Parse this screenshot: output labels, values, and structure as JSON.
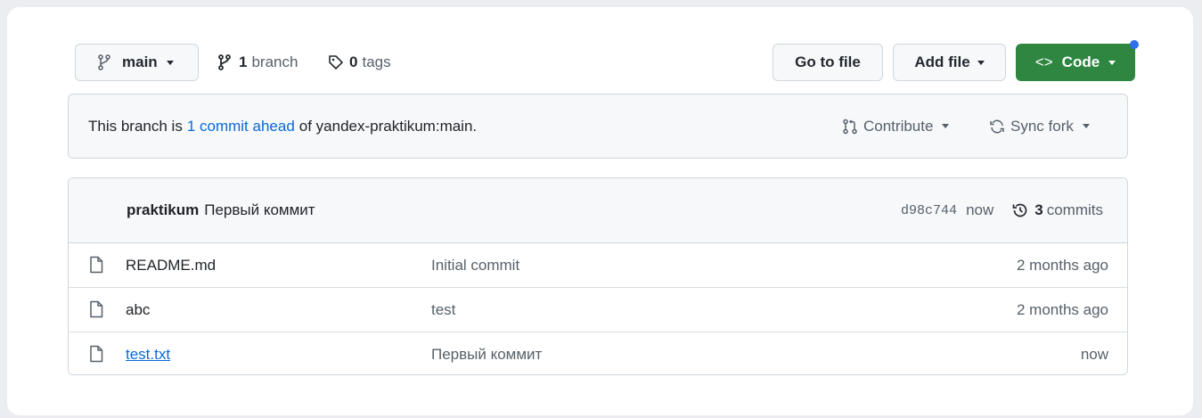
{
  "toolbar": {
    "branch_select": "main",
    "branch_count": "1",
    "branch_label": "branch",
    "tag_count": "0",
    "tag_label": "tags",
    "go_to_file": "Go to file",
    "add_file": "Add file",
    "code": "Code",
    "code_icon": "<>"
  },
  "ahead_banner": {
    "prefix": "This branch is",
    "link": "1 commit ahead",
    "suffix": "of yandex-praktikum:main.",
    "contribute": "Contribute",
    "sync_fork": "Sync fork"
  },
  "latest_commit": {
    "author": "praktikum",
    "message": "Первый коммит",
    "sha": "d98c744",
    "time": "now",
    "commit_count": "3",
    "commit_label": "commits"
  },
  "files": [
    {
      "name": "README.md",
      "message": "Initial commit",
      "age": "2 months ago"
    },
    {
      "name": "abc",
      "message": "test",
      "age": "2 months ago"
    },
    {
      "name": "test.txt",
      "message": "Первый коммит",
      "age": "now"
    }
  ],
  "colors": {
    "code_button": "#2e8640",
    "link": "#0969da",
    "notification_dot": "#2f6feb"
  }
}
